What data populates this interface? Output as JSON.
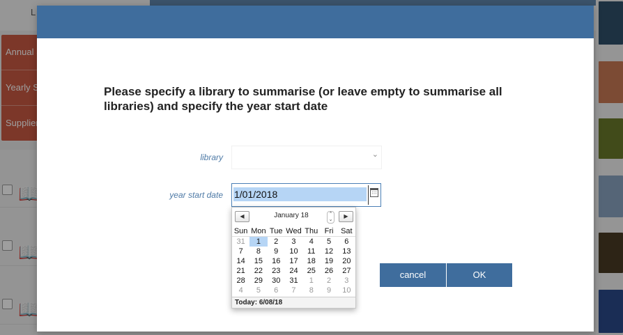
{
  "background": {
    "topbar_text": "L",
    "menu_items": [
      "Annual S",
      "Yearly S",
      "Supplier"
    ]
  },
  "dialog": {
    "prompt": "Please specify a library to summarise (or leave empty to summarise all libraries) and specify the year start date",
    "library_label": "library",
    "library_value": "",
    "year_label": "year start date",
    "year_value": "1/01/2018",
    "cancel_label": "cancel",
    "ok_label": "OK"
  },
  "calendar": {
    "month_label": "January 18",
    "weekdays": [
      "Sun",
      "Mon",
      "Tue",
      "Wed",
      "Thu",
      "Fri",
      "Sat"
    ],
    "weeks": [
      [
        "31",
        "1",
        "2",
        "3",
        "4",
        "5",
        "6"
      ],
      [
        "7",
        "8",
        "9",
        "10",
        "11",
        "12",
        "13"
      ],
      [
        "14",
        "15",
        "16",
        "17",
        "18",
        "19",
        "20"
      ],
      [
        "21",
        "22",
        "23",
        "24",
        "25",
        "26",
        "27"
      ],
      [
        "28",
        "29",
        "30",
        "31",
        "1",
        "2",
        "3"
      ],
      [
        "4",
        "5",
        "6",
        "7",
        "8",
        "9",
        "10"
      ]
    ],
    "selected_day": "1",
    "today_label": "Today: 6/08/18"
  },
  "colors": {
    "header_blue": "#3f6d9d",
    "button_blue": "#3f6d9d",
    "menu_red": "#c95a43",
    "selection_blue": "#b6d5f5"
  },
  "icons": [
    "chevron-down-icon",
    "calendar-icon",
    "book-icon",
    "prev-arrow-icon",
    "next-arrow-icon",
    "spinner-icon"
  ]
}
